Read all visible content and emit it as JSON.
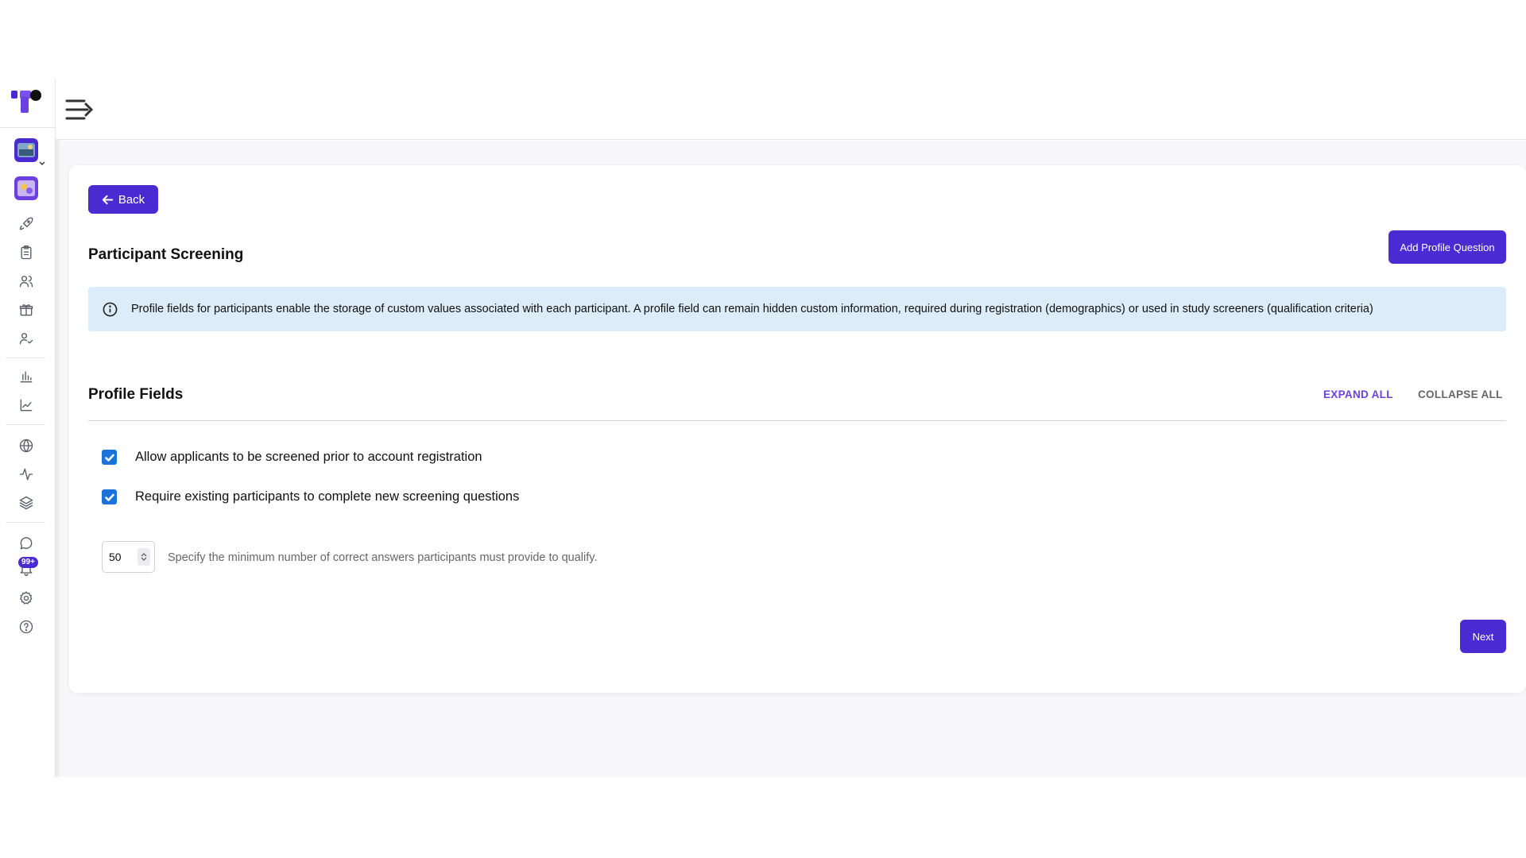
{
  "header": {
    "menu_toggle_icon": "menu-expand-icon"
  },
  "sidebar": {
    "logo_icon": "brand-logo-icon",
    "badge": "99+",
    "items": [
      {
        "name": "launch",
        "icon": "rocket-icon"
      },
      {
        "name": "tasks",
        "icon": "clipboard-icon"
      },
      {
        "name": "participants",
        "icon": "users-icon"
      },
      {
        "name": "rewards",
        "icon": "gift-icon"
      },
      {
        "name": "screening",
        "icon": "user-check-icon"
      },
      {
        "name": "reports",
        "icon": "bar-chart-icon"
      },
      {
        "name": "analytics",
        "icon": "line-chart-icon"
      },
      {
        "name": "web",
        "icon": "globe-icon"
      },
      {
        "name": "activity",
        "icon": "activity-icon"
      },
      {
        "name": "layers",
        "icon": "layers-icon"
      },
      {
        "name": "messages",
        "icon": "message-icon"
      },
      {
        "name": "notifications",
        "icon": "bell-icon"
      },
      {
        "name": "settings",
        "icon": "gear-icon"
      },
      {
        "name": "help",
        "icon": "help-icon"
      }
    ]
  },
  "main": {
    "back_label": "Back",
    "page_title": "Participant Screening",
    "add_button_label": "Add Profile Question",
    "info_text": "Profile fields for participants enable the storage of custom values associated with each participant. A profile field can remain hidden custom information, required during registration (demographics) or used in study screeners (qualification criteria)",
    "section_title": "Profile Fields",
    "expand_all": "EXPAND ALL",
    "collapse_all": "COLLAPSE ALL",
    "options": [
      {
        "label": "Allow applicants to be screened prior to account registration",
        "checked": true
      },
      {
        "label": "Require existing participants to complete new screening questions",
        "checked": true
      }
    ],
    "min_correct": {
      "value": "50",
      "hint": "Specify the minimum number of correct answers participants must provide to qualify."
    },
    "next_label": "Next"
  },
  "colors": {
    "primary": "#4a2bd1",
    "info_bg": "#dcecf9",
    "checkbox": "#1b72d8",
    "expand_link": "#6b3fe0"
  }
}
